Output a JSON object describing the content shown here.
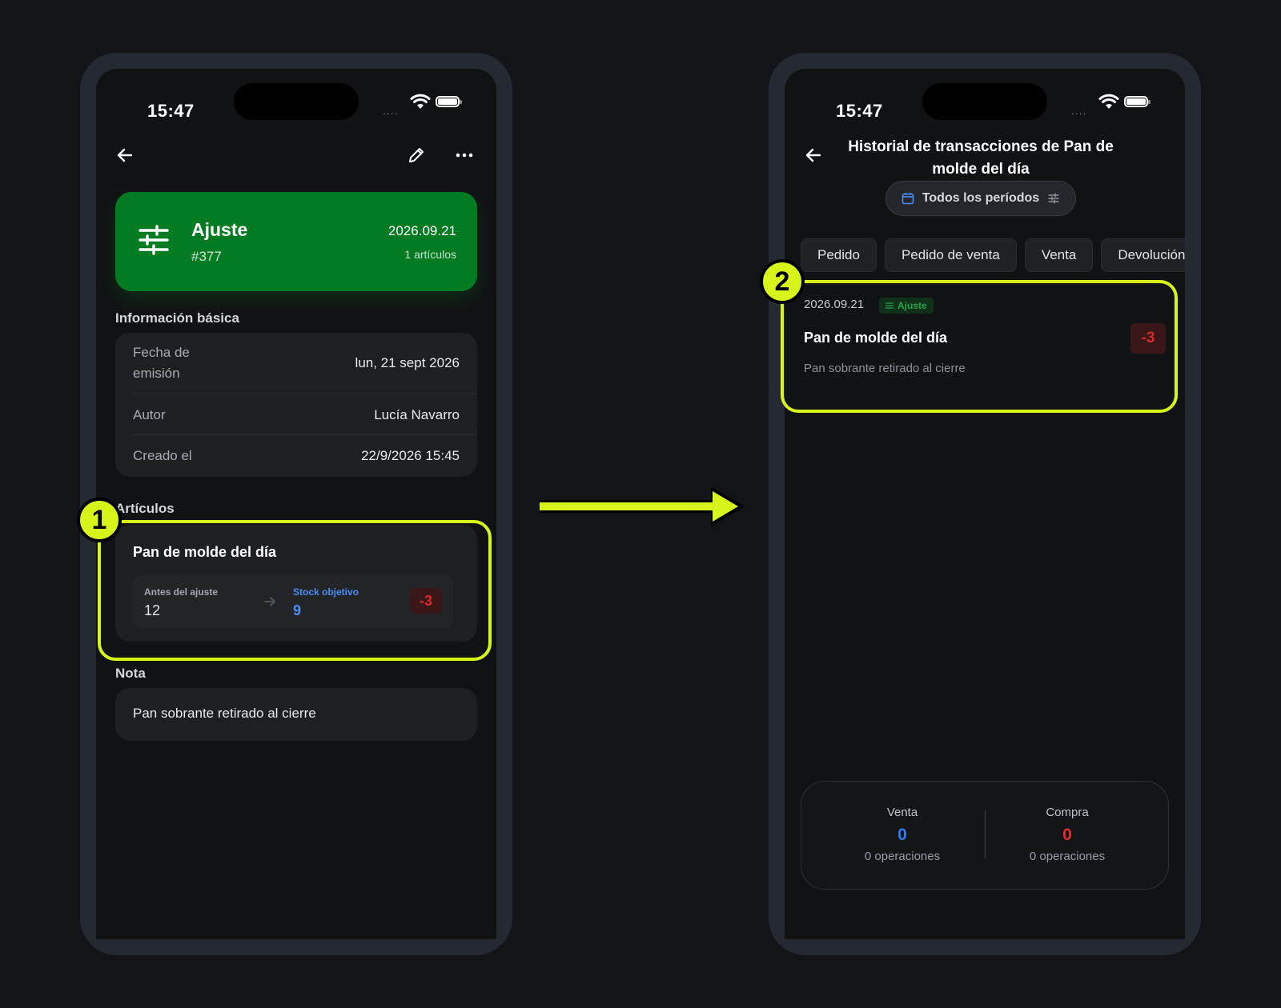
{
  "left": {
    "status_time": "15:47",
    "signal": "....",
    "hero": {
      "title": "Ajuste",
      "id": "#377",
      "date": "2026.09.21",
      "count": "1 artículos",
      "color": "#037b22"
    },
    "basic_info": {
      "label": "Información básica",
      "rows": [
        {
          "key": "Fecha de emisión",
          "value": "lun, 21 sept 2026"
        },
        {
          "key": "Autor",
          "value": "Lucía Navarro"
        },
        {
          "key": "Creado el",
          "value": "22/9/2026 15:45"
        }
      ]
    },
    "items": {
      "label": "Artículos",
      "item_name": "Pan de molde del día",
      "before_label": "Antes del ajuste",
      "before_value": "12",
      "target_label": "Stock objetivo",
      "target_value": "9",
      "delta": "-3"
    },
    "note": {
      "label": "Nota",
      "text": "Pan sobrante retirado al cierre"
    }
  },
  "right": {
    "status_time": "15:47",
    "signal": "....",
    "title": "Historial de transacciones de Pan de molde del día",
    "period_chip": "Todos los períodos",
    "filters": [
      "Pedido",
      "Pedido de venta",
      "Venta",
      "Devolución"
    ],
    "transaction": {
      "date": "2026.09.21",
      "tag": "Ajuste",
      "name": "Pan de molde del día",
      "note": "Pan sobrante retirado al cierre",
      "delta": "-3"
    },
    "summary": {
      "sale_label": "Venta",
      "sale_value": "0",
      "sale_ops": "0 operaciones",
      "purchase_label": "Compra",
      "purchase_value": "0",
      "purchase_ops": "0 operaciones"
    }
  },
  "annotations": {
    "step1": "1",
    "step2": "2",
    "highlight_color": "#d7f51a"
  },
  "colors": {
    "accent_blue": "#4a8df5",
    "negative_red": "#d92b2b",
    "sale_blue": "#2f7bf0",
    "purchase_red": "#e02d2d"
  }
}
